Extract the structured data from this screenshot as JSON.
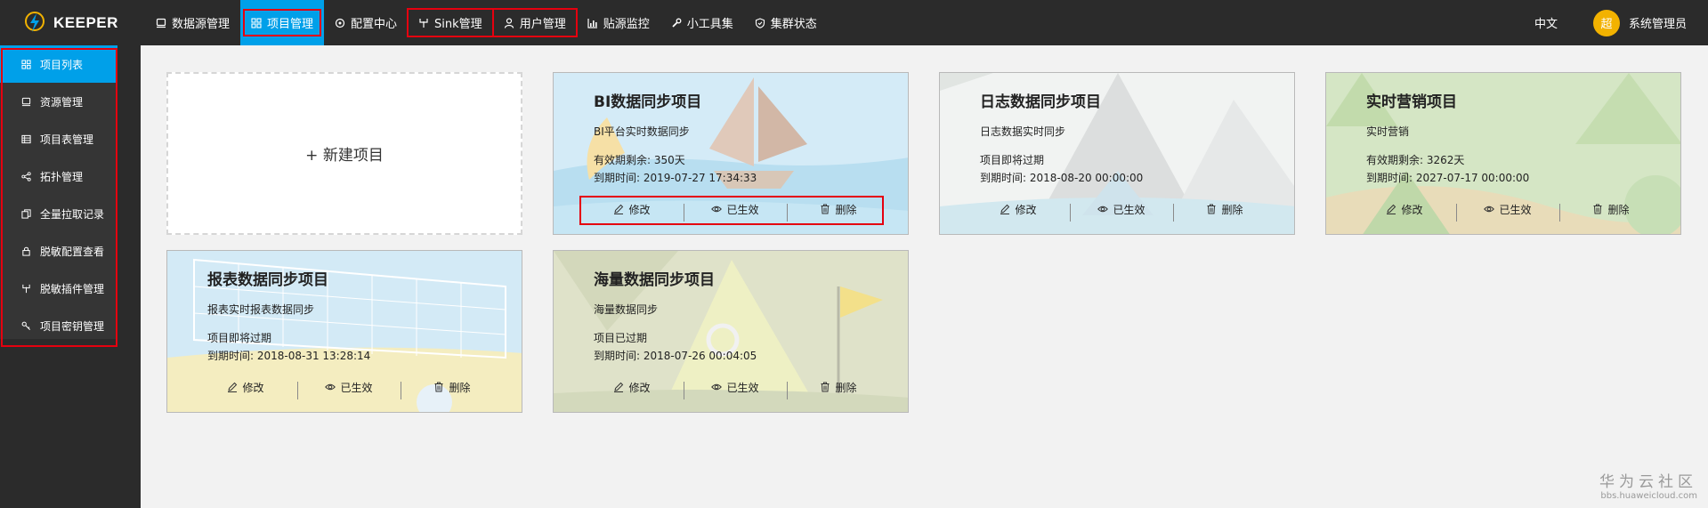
{
  "brand": {
    "name": "KEEPER"
  },
  "nav": {
    "items": [
      {
        "label": "数据源管理",
        "icon": "database-icon"
      },
      {
        "label": "项目管理",
        "icon": "grid-icon"
      },
      {
        "label": "配置中心",
        "icon": "gear-icon"
      },
      {
        "label": "Sink管理",
        "icon": "sink-icon"
      },
      {
        "label": "用户管理",
        "icon": "user-icon"
      },
      {
        "label": "贴源监控",
        "icon": "bar-chart-icon"
      },
      {
        "label": "小工具集",
        "icon": "wrench-icon"
      },
      {
        "label": "集群状态",
        "icon": "shield-icon"
      }
    ],
    "lang": "中文",
    "avatar_text": "超",
    "username": "系统管理员"
  },
  "sidebar": {
    "items": [
      {
        "label": "项目列表",
        "icon": "grid-icon"
      },
      {
        "label": "资源管理",
        "icon": "database-icon"
      },
      {
        "label": "项目表管理",
        "icon": "table-icon"
      },
      {
        "label": "拓扑管理",
        "icon": "share-icon"
      },
      {
        "label": "全量拉取记录",
        "icon": "copy-icon"
      },
      {
        "label": "脱敏配置查看",
        "icon": "lock-icon"
      },
      {
        "label": "脱敏插件管理",
        "icon": "plugin-icon"
      },
      {
        "label": "项目密钥管理",
        "icon": "key-icon"
      }
    ]
  },
  "new_project_label": "+ 新建项目",
  "actions": {
    "edit": "修改",
    "active": "已生效",
    "delete": "删除"
  },
  "projects": [
    {
      "title": "BI数据同步项目",
      "desc": "BI平台实时数据同步",
      "status": "有效期剩余: 350天",
      "expire": "到期时间: 2019-07-27 17:34:33"
    },
    {
      "title": "日志数据同步项目",
      "desc": "日志数据实时同步",
      "status": "项目即将过期",
      "expire": "到期时间: 2018-08-20 00:00:00"
    },
    {
      "title": "实时营销项目",
      "desc": "实时营销",
      "status": "有效期剩余: 3262天",
      "expire": "到期时间: 2027-07-17 00:00:00"
    },
    {
      "title": "报表数据同步项目",
      "desc": "报表实时报表数据同步",
      "status": "项目即将过期",
      "expire": "到期时间: 2018-08-31 13:28:14"
    },
    {
      "title": "海量数据同步项目",
      "desc": "海量数据同步",
      "status": "项目已过期",
      "expire": "到期时间: 2018-07-26 00:04:05"
    }
  ],
  "watermark": {
    "text": "华为云社区",
    "url": "bbs.huaweicloud.com"
  }
}
